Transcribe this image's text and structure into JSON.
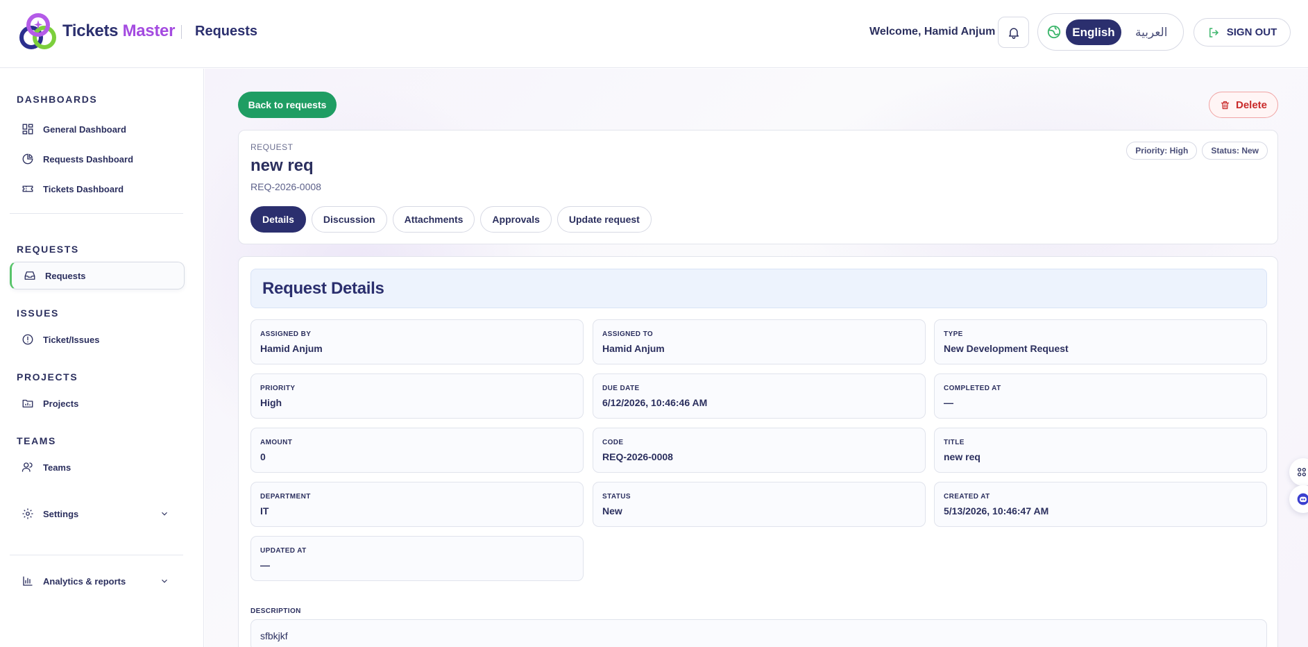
{
  "header": {
    "brand_main": "Tickets",
    "brand_accent": "Master",
    "page_title": "Requests",
    "welcome": "Welcome, Hamid Anjum",
    "lang_en": "English",
    "lang_ar": "العربية",
    "signout": "SIGN OUT"
  },
  "sidebar": {
    "dashboards_title": "DASHBOARDS",
    "general_dashboard": "General Dashboard",
    "requests_dashboard": "Requests Dashboard",
    "tickets_dashboard": "Tickets Dashboard",
    "requests_title": "REQUESTS",
    "requests": "Requests",
    "issues_title": "ISSUES",
    "ticket_issues": "Ticket/Issues",
    "projects_title": "PROJECTS",
    "projects": "Projects",
    "teams_title": "TEAMS",
    "teams": "Teams",
    "settings": "Settings",
    "analytics": "Analytics & reports"
  },
  "toolbar": {
    "back": "Back to requests",
    "delete": "Delete"
  },
  "request": {
    "kicker": "REQUEST",
    "title": "new req",
    "code": "REQ-2026-0008",
    "priority_badge": "Priority: High",
    "status_badge": "Status: New",
    "tabs": [
      "Details",
      "Discussion",
      "Attachments",
      "Approvals",
      "Update request"
    ]
  },
  "details": {
    "heading": "Request Details",
    "fields": [
      {
        "label": "ASSIGNED BY",
        "value": "Hamid Anjum"
      },
      {
        "label": "ASSIGNED TO",
        "value": "Hamid Anjum"
      },
      {
        "label": "TYPE",
        "value": "New Development Request"
      },
      {
        "label": "PRIORITY",
        "value": "High"
      },
      {
        "label": "DUE DATE",
        "value": "6/12/2026, 10:46:46 AM"
      },
      {
        "label": "COMPLETED AT",
        "value": "—"
      },
      {
        "label": "AMOUNT",
        "value": "0"
      },
      {
        "label": "CODE",
        "value": "REQ-2026-0008"
      },
      {
        "label": "TITLE",
        "value": "new req"
      },
      {
        "label": "DEPARTMENT",
        "value": "IT"
      },
      {
        "label": "STATUS",
        "value": "New"
      },
      {
        "label": "CREATED AT",
        "value": "5/13/2026, 10:46:47 AM"
      },
      {
        "label": "UPDATED AT",
        "value": "—"
      }
    ],
    "description_label": "DESCRIPTION",
    "description": "sfbkjkf"
  },
  "colors": {
    "primary": "#2b2f6e",
    "accent": "#a44be0",
    "success": "#1f9d63",
    "danger": "#c92a2a"
  }
}
